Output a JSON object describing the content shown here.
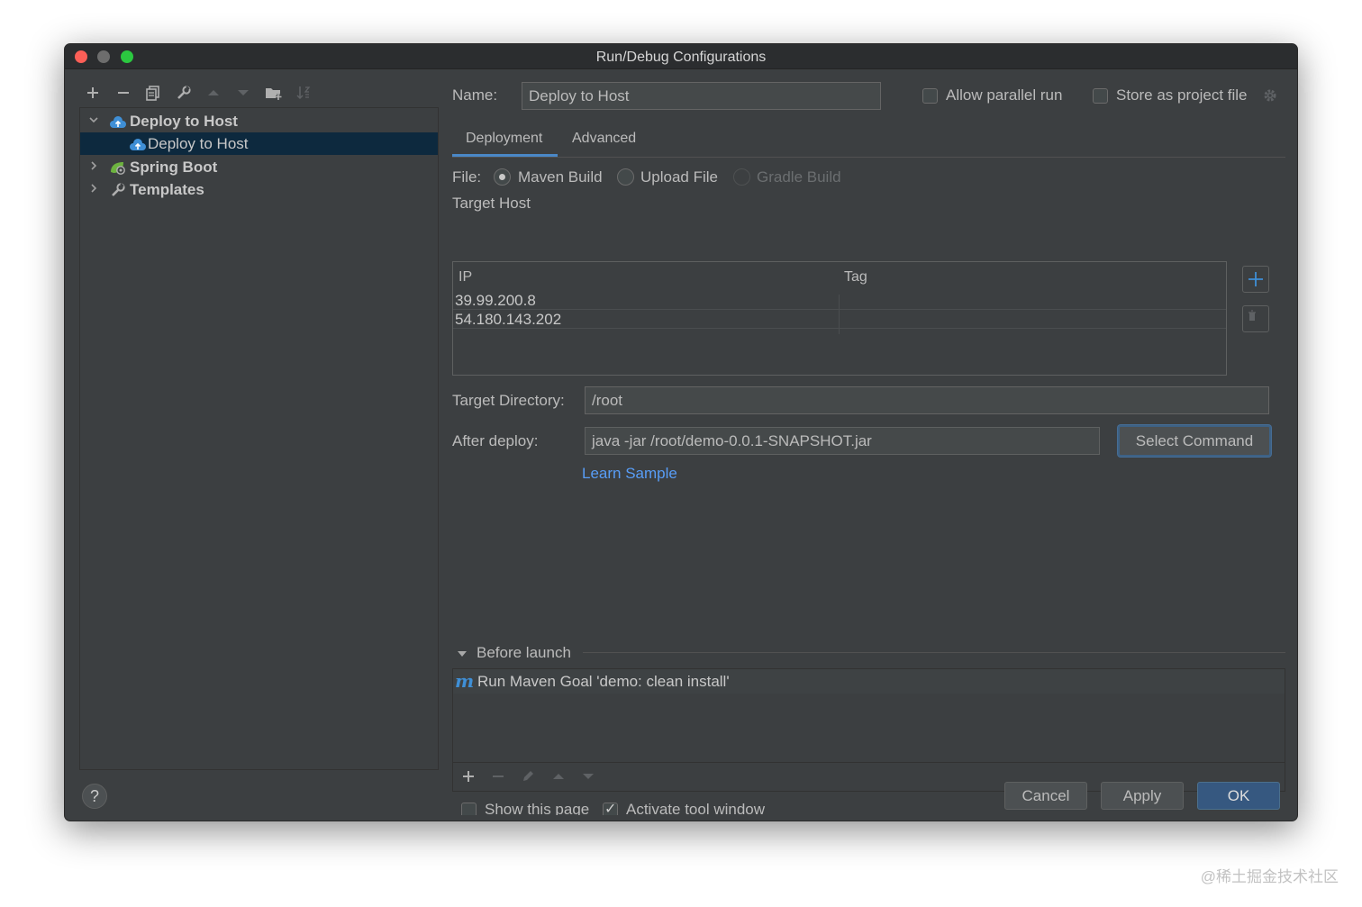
{
  "window": {
    "title": "Run/Debug Configurations"
  },
  "toolbar": {
    "icons": [
      "add-icon",
      "remove-icon",
      "copy-icon",
      "wrench-icon",
      "move-up-icon",
      "move-down-icon",
      "folder-add-icon",
      "sort-icon"
    ]
  },
  "tree": {
    "items": [
      {
        "label": "Deploy to Host",
        "icon": "cloud-upload-icon",
        "expanded": true,
        "bold": true
      },
      {
        "label": "Deploy to Host",
        "icon": "cloud-upload-icon",
        "selected": true
      },
      {
        "label": "Spring Boot",
        "icon": "spring-boot-icon",
        "expanded": false,
        "bold": true
      },
      {
        "label": "Templates",
        "icon": "wrench-icon",
        "expanded": false,
        "bold": true
      }
    ]
  },
  "form": {
    "name_label": "Name:",
    "name_value": "Deploy to Host",
    "allow_parallel_label": "Allow parallel run",
    "allow_parallel_checked": false,
    "store_project_label": "Store as project file",
    "store_project_checked": false
  },
  "tabs": [
    {
      "label": "Deployment",
      "active": true
    },
    {
      "label": "Advanced",
      "active": false
    }
  ],
  "file": {
    "label": "File:",
    "options": [
      {
        "label": "Maven Build",
        "checked": true,
        "disabled": false
      },
      {
        "label": "Upload File",
        "checked": false,
        "disabled": false
      },
      {
        "label": "Gradle Build",
        "checked": false,
        "disabled": true
      }
    ]
  },
  "target_host": {
    "label": "Target Host",
    "columns": [
      "IP",
      "Tag"
    ],
    "rows": [
      {
        "ip": "39.99.200.8",
        "tag": ""
      },
      {
        "ip": "54.180.143.202",
        "tag": ""
      }
    ]
  },
  "target_directory": {
    "label": "Target Directory:",
    "value": "/root"
  },
  "after_deploy": {
    "label": "After deploy:",
    "value": "java -jar /root/demo-0.0.1-SNAPSHOT.jar",
    "select_command": "Select Command",
    "learn_sample": "Learn Sample"
  },
  "before_launch": {
    "label": "Before launch",
    "items": [
      {
        "label": "Run Maven Goal 'demo: clean install'",
        "icon": "maven-icon"
      }
    ],
    "show_page_label": "Show this page",
    "show_page_checked": false,
    "activate_tool_label": "Activate tool window",
    "activate_tool_checked": true
  },
  "buttons": {
    "cancel": "Cancel",
    "apply": "Apply",
    "ok": "OK",
    "help": "?"
  },
  "watermark": "@稀土掘金技术社区",
  "colors": {
    "accent": "#4a88c7",
    "link": "#589df6",
    "primary_button": "#365880",
    "selection": "#0d293e"
  }
}
